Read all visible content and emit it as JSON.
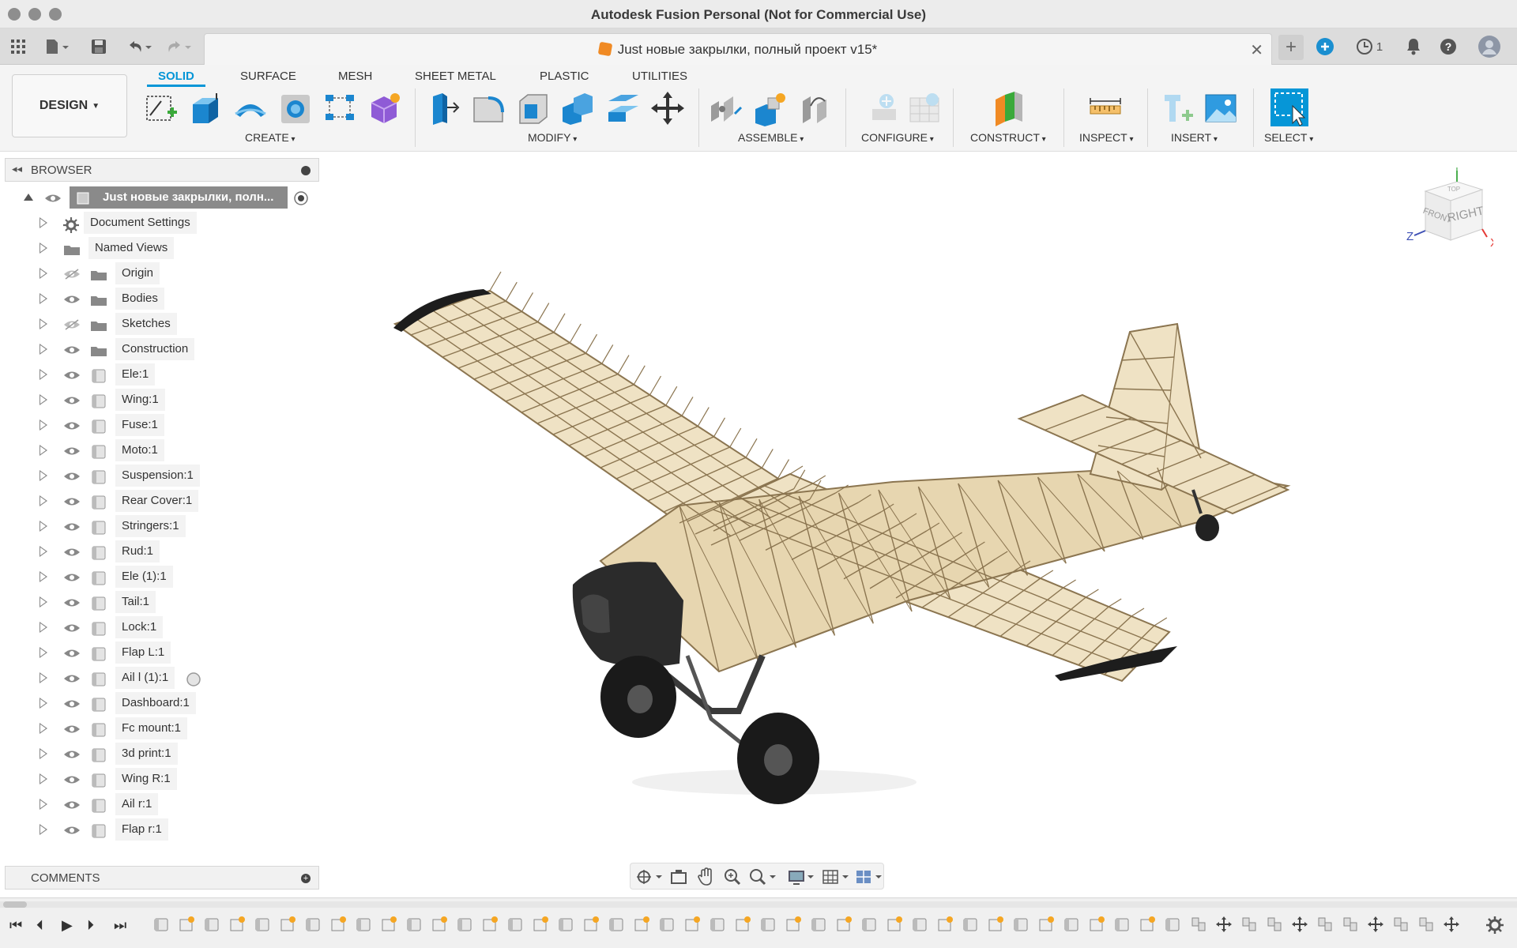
{
  "app": {
    "window_title": "Autodesk Fusion Personal (Not for Commercial Use)",
    "document_tab": "Just новые закрылки, полный проект v15*",
    "job_count": "1"
  },
  "toolbar": {
    "workspace": "DESIGN",
    "tabs": [
      "SOLID",
      "SURFACE",
      "MESH",
      "SHEET METAL",
      "PLASTIC",
      "UTILITIES"
    ],
    "groups": [
      "CREATE",
      "MODIFY",
      "ASSEMBLE",
      "CONFIGURE",
      "CONSTRUCT",
      "INSPECT",
      "INSERT",
      "SELECT"
    ]
  },
  "browser": {
    "header": "BROWSER",
    "root": "Just новые закрылки, полн...",
    "items": [
      {
        "label": "Document Settings",
        "icon": "gear-icon"
      },
      {
        "label": "Named Views",
        "icon": "folder-icon"
      },
      {
        "label": "Origin",
        "icon": "folder-icon",
        "hidden": true
      },
      {
        "label": "Bodies",
        "icon": "folder-icon"
      },
      {
        "label": "Sketches",
        "icon": "folder-icon",
        "hidden": true
      },
      {
        "label": "Construction",
        "icon": "folder-icon"
      },
      {
        "label": "Ele:1",
        "icon": "component-icon"
      },
      {
        "label": "Wing:1",
        "icon": "component-icon"
      },
      {
        "label": "Fuse:1",
        "icon": "component-icon"
      },
      {
        "label": "Moto:1",
        "icon": "component-icon"
      },
      {
        "label": "Suspension:1",
        "icon": "component-icon"
      },
      {
        "label": "Rear Cover:1",
        "icon": "component-icon"
      },
      {
        "label": "Stringers:1",
        "icon": "component-icon"
      },
      {
        "label": "Rud:1",
        "icon": "component-icon"
      },
      {
        "label": "Ele (1):1",
        "icon": "component-icon"
      },
      {
        "label": "Tail:1",
        "icon": "component-icon"
      },
      {
        "label": "Lock:1",
        "icon": "component-icon"
      },
      {
        "label": "Flap L:1",
        "icon": "component-icon"
      },
      {
        "label": "Ail l (1):1",
        "icon": "component-icon"
      },
      {
        "label": "Dashboard:1",
        "icon": "component-icon"
      },
      {
        "label": "Fc mount:1",
        "icon": "component-icon"
      },
      {
        "label": "3d print:1",
        "icon": "component-icon"
      },
      {
        "label": "Wing R:1",
        "icon": "component-icon"
      },
      {
        "label": "Ail r:1",
        "icon": "component-icon"
      },
      {
        "label": "Flap r:1",
        "icon": "component-icon"
      }
    ]
  },
  "comments": {
    "header": "COMMENTS"
  },
  "viewcube": {
    "front": "FRONT",
    "right": "RIGHT",
    "top": "TOP",
    "axis_x": "X",
    "axis_y": "Y",
    "axis_z": "Z"
  },
  "colors": {
    "accent": "#0696d7",
    "frame": "#c2ad86",
    "frame_dark": "#7d6a45"
  }
}
